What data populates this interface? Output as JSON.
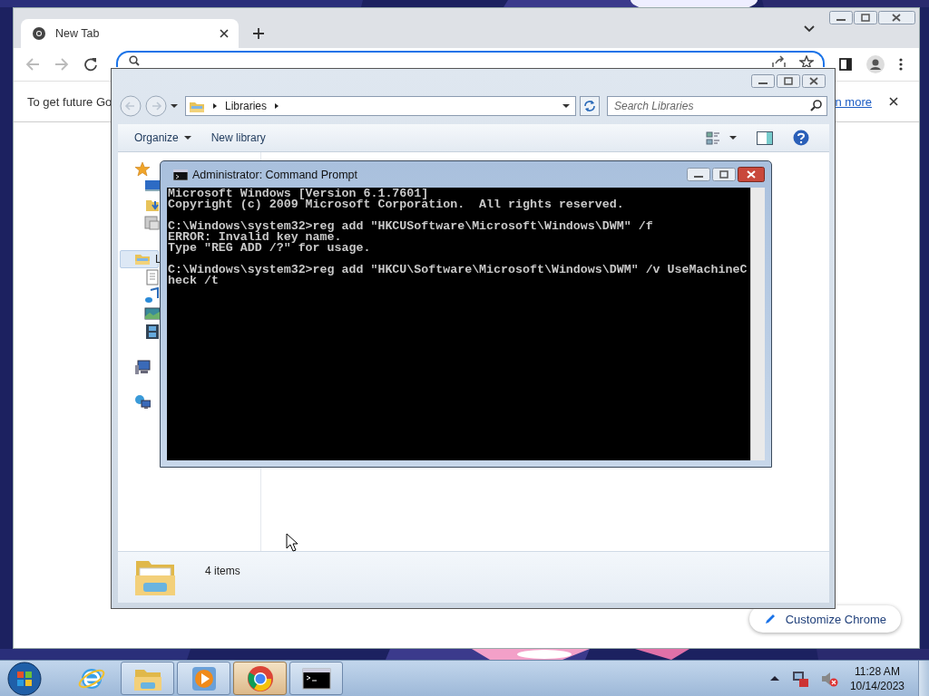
{
  "browser": {
    "tabs": [
      {
        "label": "New Tab",
        "selected": true
      }
    ],
    "infobar": {
      "text": "To get future Go",
      "link": "n more"
    },
    "customize_button": "Customize Chrome"
  },
  "explorer": {
    "breadcrumb": [
      "Libraries"
    ],
    "search": {
      "placeholder": "Search Libraries"
    },
    "toolbar": [
      "Organize",
      "New library"
    ],
    "nav": [
      {
        "selected": false
      },
      {
        "label": "L",
        "selected": true
      },
      {
        "selected": false
      },
      {
        "selected": false
      }
    ],
    "status": "4 items"
  },
  "console": {
    "title": "Administrator:  Command Prompt",
    "blocks": [
      [
        "Microsoft Windows [Version 6.1.7601]",
        "Copyright (c) 2009 Microsoft Corporation.  All rights reserved."
      ],
      [
        "C:\\Windows\\system32>reg add \"HKCUSoftware\\Microsoft\\Windows\\DWM\" /f",
        "ERROR: Invalid key name.",
        "Type \"REG ADD /?\" for usage."
      ],
      [
        "C:\\Windows\\system32>reg add \"HKCU\\Software\\Microsoft\\Windows\\DWM\" /v UseMachineC",
        "heck /t"
      ]
    ]
  },
  "taskbar": {
    "apps": [
      {
        "kind": "ebrowser",
        "open": false,
        "selected": false
      },
      {
        "kind": "folder",
        "open": true,
        "selected": false
      },
      {
        "kind": "player",
        "open": true,
        "selected": false
      },
      {
        "kind": "ringbrowser",
        "open": true,
        "selected": true
      },
      {
        "kind": "console",
        "open": true,
        "selected": false
      }
    ],
    "clock": {
      "time": "11:28 AM",
      "date": "10/14/2023"
    }
  }
}
